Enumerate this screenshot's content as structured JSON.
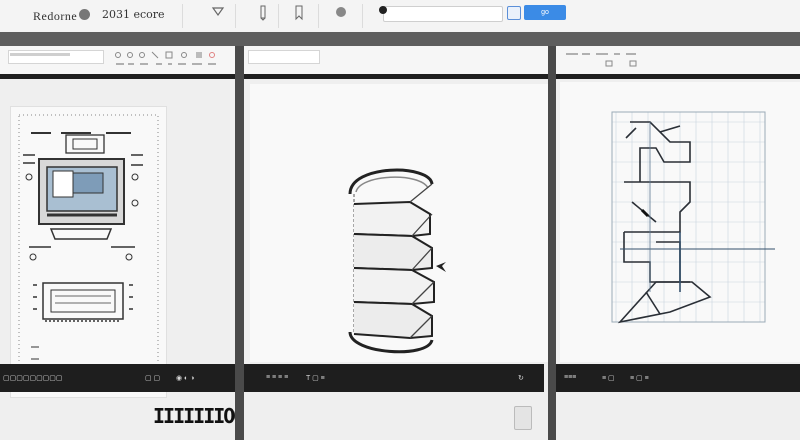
{
  "toolbar": {
    "brand": "Redorne",
    "version": "2031 ecore",
    "go_button": "go",
    "tools": [
      "funnel-icon",
      "pencil-icon",
      "bookmark-icon",
      "circle-icon"
    ]
  },
  "panels": [
    {
      "id": "panel-1",
      "toolbar_icons": [
        "grid-icon",
        "prev-icon",
        "play-icon",
        "dot-icon",
        "settings-icon"
      ],
      "statusbar": [
        "▢▢▢▢▢▢▢▢▢",
        "▢ ▢",
        "◉ ◐ ◑"
      ],
      "footer_code": "IIIIIIIOO"
    },
    {
      "id": "panel-2",
      "statusbar": [
        "≡ ≡ ≡ ≡",
        "T ▢ ≡",
        "↻"
      ]
    },
    {
      "id": "panel-3",
      "statusbar": [
        "≡≡≡",
        "≡ ▢",
        "≡ ▢ ≡"
      ]
    }
  ],
  "colors": {
    "accent": "#3b8be6",
    "dark": "#1e1e1e",
    "blueprint": "#7d9bb5"
  }
}
